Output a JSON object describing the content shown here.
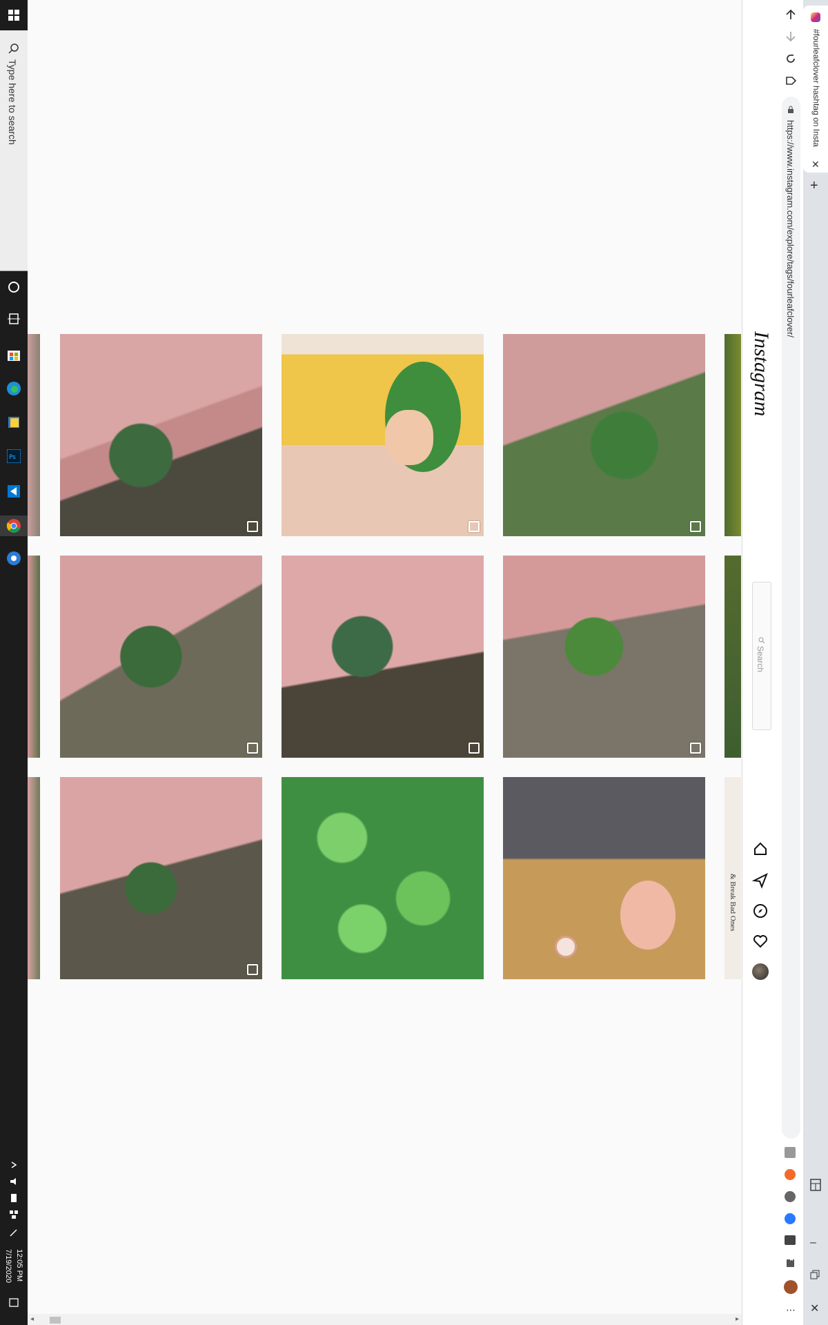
{
  "taskbar": {
    "search_placeholder": "Type here to search",
    "time": "12:05 PM",
    "date": "7/19/2020",
    "apps": [
      "store-icon",
      "edge-icon",
      "file-explorer-icon",
      "photoshop-icon",
      "vscode-icon",
      "chrome-icon",
      "settings-icon"
    ]
  },
  "browser": {
    "tab_title": "#fourleafclover hashtag on Insta",
    "url": "https://www.instagram.com/explore/tags/fourleafclover/",
    "new_tab_label": "+",
    "extensions": [
      "grammarly-icon",
      "extension-orange-icon",
      "extension-circle-icon",
      "extension-blue-icon",
      "extension-monitor-icon",
      "puzzle-icon",
      "profile-avatar-icon"
    ]
  },
  "instagram": {
    "logo": "Instagram",
    "search_placeholder": "Search",
    "nav": [
      "home-icon",
      "direct-icon",
      "explore-icon",
      "activity-icon",
      "profile-icon"
    ]
  },
  "posts": [
    {
      "row": 1,
      "col": 1,
      "type": "carousel",
      "desc": "hand-clover-1"
    },
    {
      "row": 1,
      "col": 2,
      "type": "carousel",
      "desc": "illustration-girl-clover"
    },
    {
      "row": 1,
      "col": 3,
      "type": "carousel",
      "desc": "hand-clover-2"
    },
    {
      "row": 2,
      "col": 1,
      "type": "carousel",
      "desc": "hand-clover-3"
    },
    {
      "row": 2,
      "col": 2,
      "type": "carousel",
      "desc": "hand-clover-4"
    },
    {
      "row": 2,
      "col": 3,
      "type": "carousel",
      "desc": "hand-clover-5"
    },
    {
      "row": 3,
      "col": 1,
      "type": "carousel",
      "desc": "hand-clover-6"
    },
    {
      "row": 3,
      "col": 2,
      "type": "single",
      "desc": "clover-patch"
    },
    {
      "row": 3,
      "col": 3,
      "type": "single",
      "desc": "ear-earring"
    }
  ],
  "partial_post_text": "& Break Bad Ones",
  "colors": {
    "taskbar": "#1c1c1c",
    "page_bg": "#fafafa",
    "accent_clover": "#3f8f43"
  }
}
